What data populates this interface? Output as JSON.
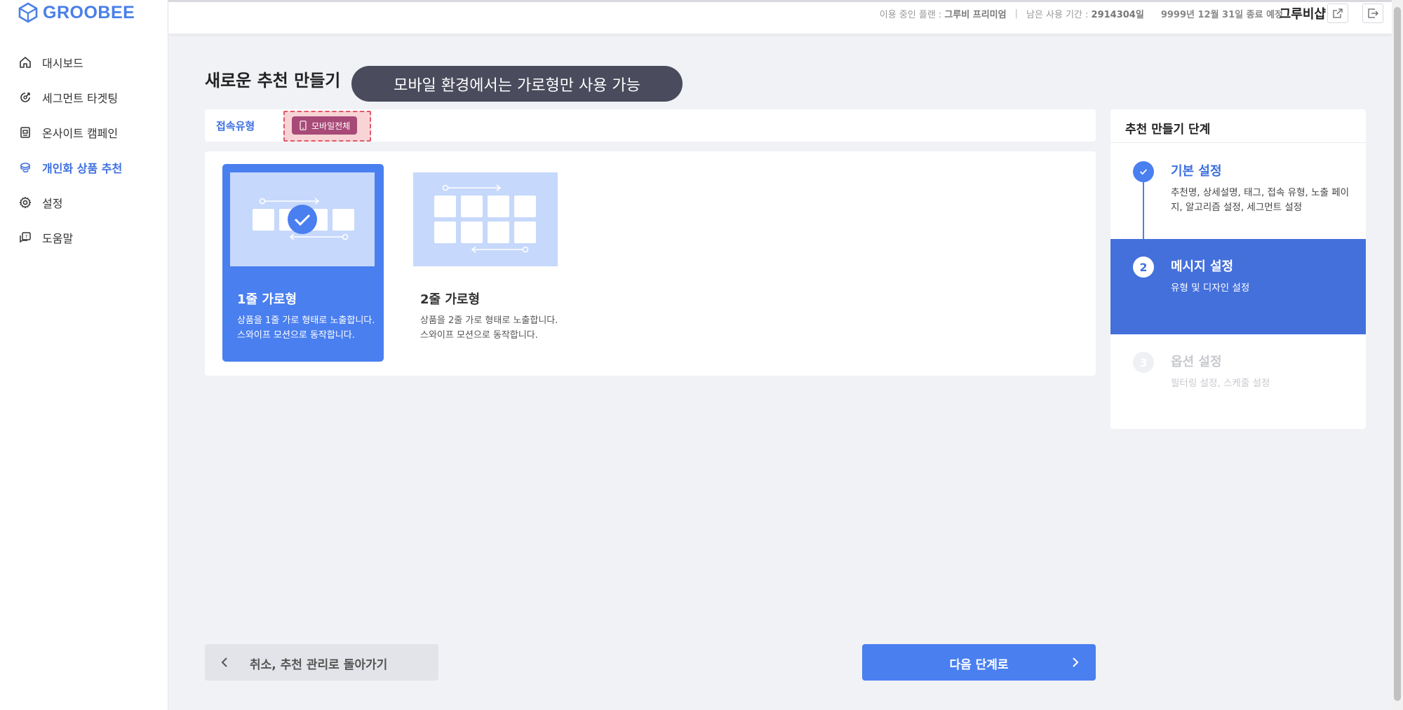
{
  "app": {
    "logo_text": "GROOBEE"
  },
  "sidebar": {
    "items": [
      {
        "label": "대시보드",
        "icon": "home-icon"
      },
      {
        "label": "세그먼트 타겟팅",
        "icon": "target-icon"
      },
      {
        "label": "온사이트 캠페인",
        "icon": "campaign-icon"
      },
      {
        "label": "개인화 상품 추천",
        "icon": "recommend-icon",
        "active": true
      },
      {
        "label": "설정",
        "icon": "gear-icon"
      },
      {
        "label": "도움말",
        "icon": "help-icon"
      }
    ]
  },
  "header": {
    "plan_label": "이용 중인 플랜 :",
    "plan_value": "그루비 프리미엄",
    "remaining_label": "남은 사용 기간 :",
    "remaining_value": "2914304일",
    "expire_text": "9999년 12월 31일 종료 예정",
    "shop_name": "그루비샵",
    "external_link_icon": "external-link-icon",
    "logout_icon": "logout-icon"
  },
  "page": {
    "title": "새로운 추천 만들기",
    "tooltip": "모바일 환경에서는 가로형만 사용 가능"
  },
  "connection": {
    "label": "접속유형",
    "tag_label": "모바일전체",
    "tag_icon": "mobile-icon"
  },
  "cards": [
    {
      "title": "1줄 가로형",
      "description": "상품을 1줄 가로 형태로 노출합니다. 스와이프 모션으로 동작합니다.",
      "selected": true
    },
    {
      "title": "2줄 가로형",
      "description": "상품을 2줄 가로 형태로 노출합니다. 스와이프 모션으로 동작합니다.",
      "selected": false
    }
  ],
  "steps": {
    "title": "추천 만들기 단계",
    "items": [
      {
        "number": "",
        "name": "기본 설정",
        "description": "추천명, 상세설명, 태그, 접속 유형, 노출 페이지, 알고리즘 설정, 세그먼트 설정",
        "state": "done"
      },
      {
        "number": "2",
        "name": "메시지 설정",
        "description": "유형 및 디자인 설정",
        "state": "current"
      },
      {
        "number": "3",
        "name": "옵션 설정",
        "description": "필터링 설정, 스케줄 설정",
        "state": "pending"
      }
    ]
  },
  "buttons": {
    "cancel_label": "취소, 추천 관리로 돌아가기",
    "next_label": "다음 단계로"
  },
  "colors": {
    "primary": "#4a7ff0",
    "step_active": "#4470dc",
    "tooltip_bg": "#4a4b5c",
    "tag_bg": "#a84a78",
    "highlight_border": "#e05a6a"
  }
}
